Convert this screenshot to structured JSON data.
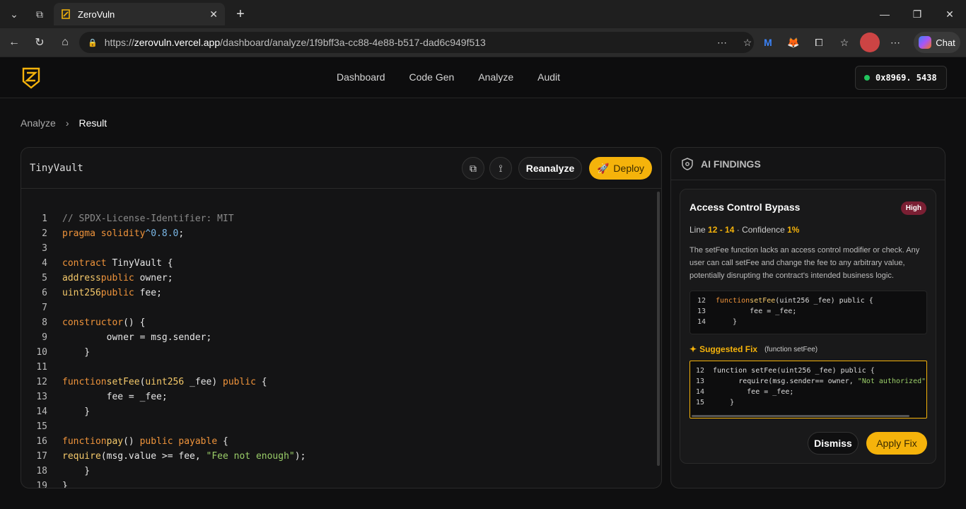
{
  "browser": {
    "tab_title": "ZeroVuln",
    "url_prefix": "https://",
    "url_host": "zerovuln.vercel.app",
    "url_path": "/dashboard/analyze/1f9bff3a-cc88-4e88-b517-dad6c949f513",
    "chat_label": "Chat"
  },
  "nav": {
    "items": [
      "Dashboard",
      "Code Gen",
      "Analyze",
      "Audit"
    ],
    "wallet": "0x8969. 5438"
  },
  "breadcrumb": {
    "parent": "Analyze",
    "current": "Result"
  },
  "editor": {
    "title": "TinyVault",
    "reanalyze": "Reanalyze",
    "deploy": "Deploy"
  },
  "findings": {
    "header": "AI FINDINGS",
    "title": "Access Control Bypass",
    "severity": "High",
    "line_label": "Line",
    "lines": "12 - 14",
    "confidence_label": "· Confidence",
    "confidence": "1%",
    "description": "The setFee function lacks an access control modifier or check. Any user can call setFee and change the fee to any arbitrary value, potentially disrupting the contract's intended business logic.",
    "fix_label": "Suggested Fix",
    "fix_sub": "(function setFee)",
    "dismiss": "Dismiss",
    "apply": "Apply Fix"
  },
  "colors": {
    "accent": "#f5b30b",
    "severity_high": "#7a1f33",
    "wallet_dot": "#22c55e"
  }
}
